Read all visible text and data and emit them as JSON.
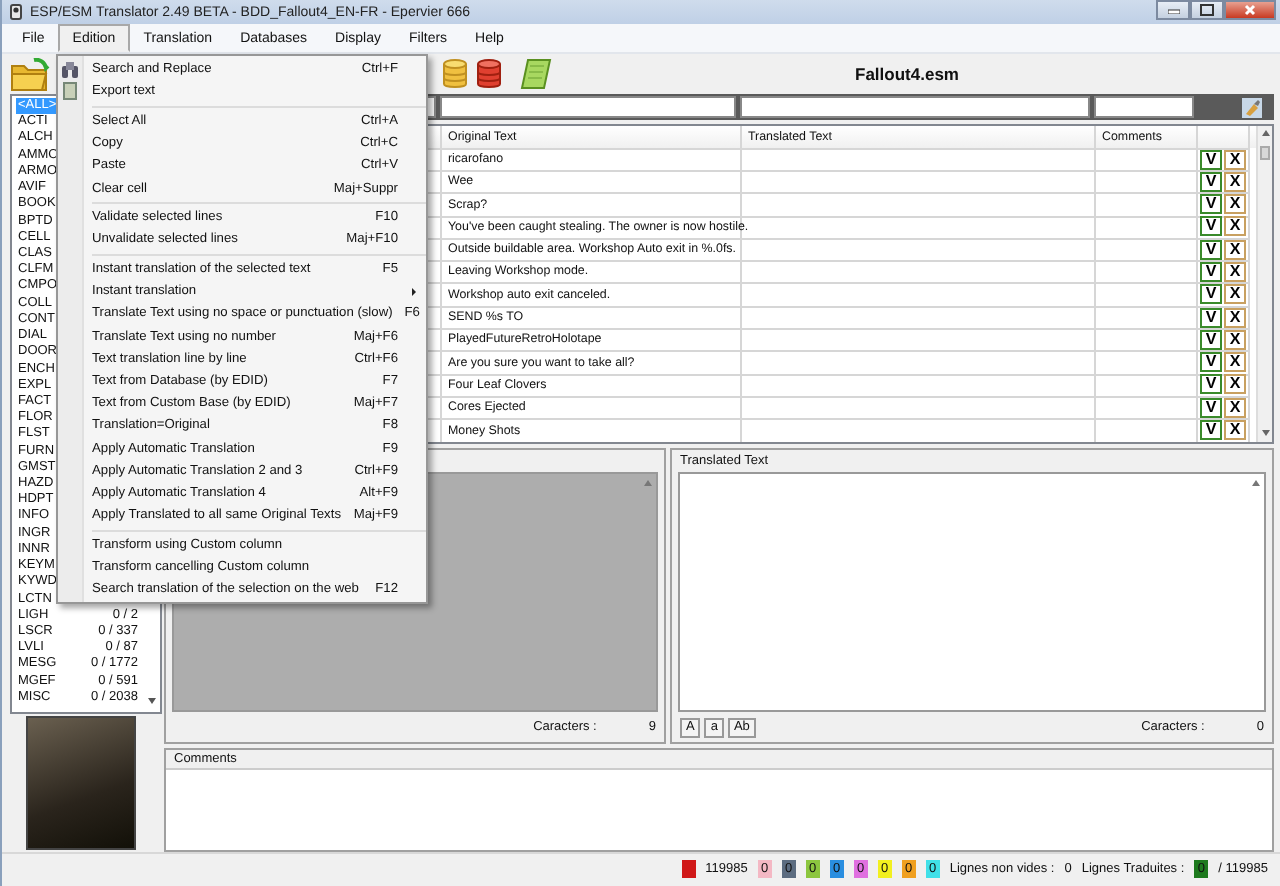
{
  "window": {
    "title": "ESP/ESM Translator 2.49 BETA - BDD_Fallout4_EN-FR - Epervier 666"
  },
  "menubar": [
    {
      "label": "File",
      "selected": false
    },
    {
      "label": "Edition",
      "selected": true
    },
    {
      "label": "Translation",
      "selected": false
    },
    {
      "label": "Databases",
      "selected": false
    },
    {
      "label": "Display",
      "selected": false
    },
    {
      "label": "Filters",
      "selected": false
    },
    {
      "label": "Help",
      "selected": false
    }
  ],
  "menu": [
    {
      "kind": "item",
      "label": "Search and Replace",
      "shortcut": "Ctrl+F",
      "has_icon": true,
      "submenu": false
    },
    {
      "kind": "item",
      "label": "Export text",
      "has_icon": true,
      "submenu": false
    },
    {
      "kind": "separator"
    },
    {
      "kind": "item",
      "label": "Select All",
      "shortcut": "Ctrl+A",
      "has_icon": false,
      "submenu": false
    },
    {
      "kind": "item",
      "label": "Copy",
      "shortcut": "Ctrl+C",
      "has_icon": false,
      "submenu": false
    },
    {
      "kind": "item",
      "label": "Paste",
      "shortcut": "Ctrl+V",
      "has_icon": false,
      "submenu": false
    },
    {
      "kind": "item",
      "label": "Clear cell",
      "shortcut": "Maj+Suppr",
      "has_icon": false,
      "submenu": false
    },
    {
      "kind": "separator"
    },
    {
      "kind": "item",
      "label": "Validate selected lines",
      "shortcut": "F10",
      "has_icon": false,
      "submenu": false
    },
    {
      "kind": "item",
      "label": "Unvalidate selected lines",
      "shortcut": "Maj+F10",
      "has_icon": false,
      "submenu": false
    },
    {
      "kind": "separator"
    },
    {
      "kind": "item",
      "label": "Instant translation of the selected text",
      "shortcut": "F5",
      "has_icon": false,
      "submenu": false
    },
    {
      "kind": "item",
      "label": "Instant translation",
      "has_icon": false,
      "submenu": true
    },
    {
      "kind": "item",
      "label": "Translate Text using no space or punctuation (slow)",
      "shortcut": "F6",
      "has_icon": false,
      "submenu": false
    },
    {
      "kind": "item",
      "label": "Translate Text using no number",
      "shortcut": "Maj+F6",
      "has_icon": false,
      "submenu": false
    },
    {
      "kind": "item",
      "label": "Text translation line by line",
      "shortcut": "Ctrl+F6",
      "has_icon": false,
      "submenu": false
    },
    {
      "kind": "item",
      "label": "Text from Database (by EDID)",
      "shortcut": "F7",
      "has_icon": false,
      "submenu": false
    },
    {
      "kind": "item",
      "label": "Text from Custom Base (by EDID)",
      "shortcut": "Maj+F7",
      "has_icon": false,
      "submenu": false
    },
    {
      "kind": "item",
      "label": "Translation=Original",
      "shortcut": "F8",
      "has_icon": false,
      "submenu": false
    },
    {
      "kind": "item",
      "label": "Apply Automatic Translation",
      "shortcut": "F9",
      "has_icon": false,
      "submenu": false
    },
    {
      "kind": "item",
      "label": "Apply Automatic Translation 2 and 3",
      "shortcut": "Ctrl+F9",
      "has_icon": false,
      "submenu": false
    },
    {
      "kind": "item",
      "label": "Apply Automatic Translation 4",
      "shortcut": "Alt+F9",
      "has_icon": false,
      "submenu": false
    },
    {
      "kind": "item",
      "label": "Apply Translated to all same Original Texts",
      "shortcut": "Maj+F9",
      "has_icon": false,
      "submenu": false
    },
    {
      "kind": "separator"
    },
    {
      "kind": "item",
      "label": "Transform using Custom column",
      "has_icon": false,
      "submenu": false
    },
    {
      "kind": "item",
      "label": "Transform cancelling Custom column",
      "has_icon": false,
      "submenu": false
    },
    {
      "kind": "item",
      "label": "Search translation of the selection on the web",
      "shortcut": "F12",
      "has_icon": false,
      "submenu": false
    }
  ],
  "toolbar": {
    "file_name": "Fallout4.esm"
  },
  "categories": [
    {
      "label": "<ALL>",
      "selected": true
    },
    {
      "label": "ACTI",
      "selected": false
    },
    {
      "label": "ALCH",
      "selected": false
    },
    {
      "label": "AMMO",
      "selected": false
    },
    {
      "label": "ARMO",
      "selected": false
    },
    {
      "label": "AVIF",
      "selected": false
    },
    {
      "label": "BOOK",
      "selected": false
    },
    {
      "label": "BPTD",
      "selected": false
    },
    {
      "label": "CELL",
      "selected": false
    },
    {
      "label": "CLAS",
      "selected": false
    },
    {
      "label": "CLFM",
      "selected": false
    },
    {
      "label": "CMPO",
      "selected": false
    },
    {
      "label": "COLL",
      "selected": false
    },
    {
      "label": "CONT",
      "selected": false
    },
    {
      "label": "DIAL",
      "selected": false
    },
    {
      "label": "DOOR",
      "selected": false
    },
    {
      "label": "ENCH",
      "selected": false
    },
    {
      "label": "EXPL",
      "selected": false
    },
    {
      "label": "FACT",
      "selected": false
    },
    {
      "label": "FLOR",
      "selected": false
    },
    {
      "label": "FLST",
      "selected": false
    },
    {
      "label": "FURN",
      "selected": false
    },
    {
      "label": "GMST",
      "selected": false
    },
    {
      "label": "HAZD",
      "selected": false
    },
    {
      "label": "HDPT",
      "selected": false
    },
    {
      "label": "INFO",
      "selected": false
    },
    {
      "label": "INGR",
      "selected": false
    },
    {
      "label": "INNR",
      "selected": false
    },
    {
      "label": "KEYM",
      "selected": false
    },
    {
      "label": "KYWD",
      "selected": false
    },
    {
      "label": "LCTN",
      "selected": false
    },
    {
      "label": "LIGH",
      "count": "0 / 2",
      "selected": false
    },
    {
      "label": "LSCR",
      "count": "0 / 337",
      "selected": false
    },
    {
      "label": "LVLI",
      "count": "0 / 87",
      "selected": false
    },
    {
      "label": "MESG",
      "count": "0 / 1772",
      "selected": false
    },
    {
      "label": "MGEF",
      "count": "0 / 591",
      "selected": false
    },
    {
      "label": "MISC",
      "count": "0 / 2038",
      "selected": false
    }
  ],
  "table": {
    "columns": [
      "Original Text",
      "Translated Text",
      "Comments"
    ],
    "rows": [
      {
        "original_text": "ricarofano",
        "buttons": [
          "V",
          "X"
        ]
      },
      {
        "original_text": "Wee",
        "buttons": [
          "V",
          "X"
        ]
      },
      {
        "original_text": "Scrap?",
        "buttons": [
          "V",
          "X"
        ]
      },
      {
        "original_text": "You've been caught stealing. The owner is now hostile.",
        "buttons": [
          "V",
          "X"
        ]
      },
      {
        "original_text": "Outside buildable area. Workshop Auto exit in %.0fs.",
        "buttons": [
          "V",
          "X"
        ]
      },
      {
        "original_text": "Leaving Workshop mode.",
        "buttons": [
          "V",
          "X"
        ]
      },
      {
        "original_text": "Workshop auto exit canceled.",
        "buttons": [
          "V",
          "X"
        ]
      },
      {
        "original_text": "SEND %s TO",
        "buttons": [
          "V",
          "X"
        ]
      },
      {
        "original_text": "PlayedFutureRetroHolotape",
        "buttons": [
          "V",
          "X"
        ]
      },
      {
        "original_text": "Are you sure you want to take all?",
        "buttons": [
          "V",
          "X"
        ]
      },
      {
        "original_text": "Four Leaf Clovers",
        "buttons": [
          "V",
          "X"
        ]
      },
      {
        "original_text": "Cores Ejected",
        "buttons": [
          "V",
          "X"
        ]
      },
      {
        "original_text": "Money Shots",
        "buttons": [
          "V",
          "X"
        ]
      }
    ]
  },
  "original_pane": {
    "caracters_label": "Caracters :",
    "caracters_value": "9"
  },
  "translated_pane": {
    "title": "Translated Text",
    "case_buttons": [
      "A",
      "a",
      "Ab"
    ],
    "caracters_label": "Caracters :",
    "caracters_value": "0"
  },
  "comments": {
    "title": "Comments"
  },
  "status_bar": [
    {
      "kind": "swatch",
      "color": "#d01818"
    },
    {
      "kind": "text",
      "text": "119985"
    },
    {
      "kind": "swatch",
      "color": "#f4b8c4",
      "value": "0"
    },
    {
      "kind": "swatch",
      "color": "#5c6c80",
      "value": "0"
    },
    {
      "kind": "swatch",
      "color": "#8cc63f",
      "value": "0"
    },
    {
      "kind": "swatch",
      "color": "#2a8ee0",
      "value": "0"
    },
    {
      "kind": "swatch",
      "color": "#e070e0",
      "value": "0"
    },
    {
      "kind": "swatch",
      "color": "#f2f020",
      "value": "0"
    },
    {
      "kind": "swatch",
      "color": "#f0a020",
      "value": "0"
    },
    {
      "kind": "swatch",
      "color": "#40e0e8",
      "value": "0"
    },
    {
      "kind": "text",
      "text": "Lignes non vides :"
    },
    {
      "kind": "text",
      "text": "0"
    },
    {
      "kind": "text",
      "text": "Lignes Traduites :"
    },
    {
      "kind": "swatch",
      "color": "#1e7a1e",
      "value": "0"
    },
    {
      "kind": "text",
      "text": "/ 119985"
    }
  ]
}
